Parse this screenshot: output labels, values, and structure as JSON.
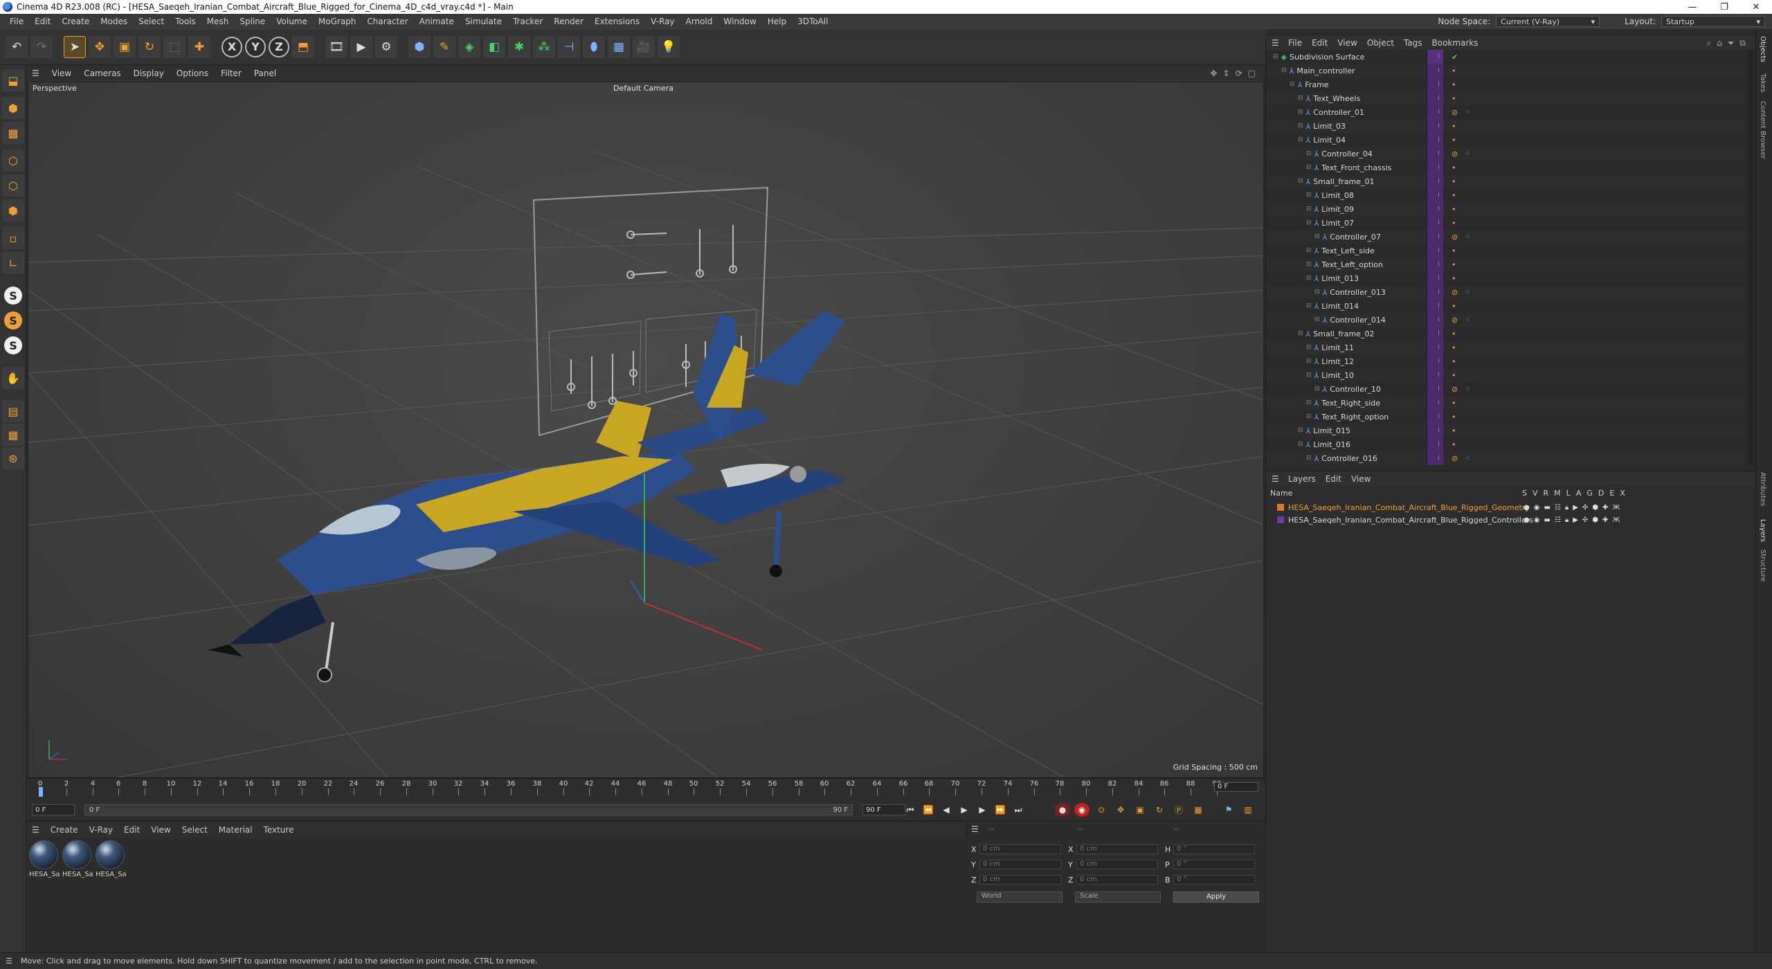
{
  "window": {
    "title": "Cinema 4D R23.008 (RC) - [HESA_Saeqeh_Iranian_Combat_Aircraft_Blue_Rigged_for_Cinema_4D_c4d_vray.c4d *] - Main"
  },
  "menubar": {
    "items": [
      "File",
      "Edit",
      "Create",
      "Modes",
      "Select",
      "Tools",
      "Mesh",
      "Spline",
      "Volume",
      "MoGraph",
      "Character",
      "Animate",
      "Simulate",
      "Tracker",
      "Render",
      "Extensions",
      "V-Ray",
      "Arnold",
      "Window",
      "Help",
      "3DToAll"
    ],
    "node_space_label": "Node Space:",
    "node_space_value": "Current (V-Ray)",
    "layout_label": "Layout:",
    "layout_value": "Startup"
  },
  "viewport": {
    "menu": [
      "View",
      "Cameras",
      "Display",
      "Options",
      "Filter",
      "Panel"
    ],
    "projection": "Perspective",
    "camera": "Default Camera",
    "grid_spacing": "Grid Spacing : 500 cm"
  },
  "timeline": {
    "ticks": [
      "0",
      "2",
      "4",
      "6",
      "8",
      "10",
      "12",
      "14",
      "16",
      "18",
      "20",
      "22",
      "24",
      "26",
      "28",
      "30",
      "32",
      "34",
      "36",
      "38",
      "40",
      "42",
      "44",
      "46",
      "48",
      "50",
      "52",
      "54",
      "56",
      "58",
      "60",
      "62",
      "64",
      "66",
      "68",
      "70",
      "72",
      "74",
      "76",
      "78",
      "80",
      "82",
      "84",
      "86",
      "88",
      "90"
    ],
    "current_frame": "0 F",
    "start_frame": "0 F",
    "range_start": "0 F",
    "range_end": "90 F",
    "end_frame": "90 F"
  },
  "materials": {
    "menu": [
      "Create",
      "V-Ray",
      "Edit",
      "View",
      "Select",
      "Material",
      "Texture"
    ],
    "items": [
      "HESA_Sa",
      "HESA_Sa",
      "HESA_Sa"
    ]
  },
  "coordinates": {
    "pos_labels": [
      "X",
      "Y",
      "Z"
    ],
    "size_labels": [
      "X",
      "Y",
      "Z"
    ],
    "rot_labels": [
      "H",
      "P",
      "B"
    ],
    "pos_values": [
      "0 cm",
      "0 cm",
      "0 cm"
    ],
    "size_values": [
      "0 cm",
      "0 cm",
      "0 cm"
    ],
    "rot_values": [
      "0 °",
      "0 °",
      "0 °"
    ],
    "mode": "World",
    "scale": "Scale",
    "apply": "Apply",
    "dashes": [
      "--",
      "--",
      "--"
    ]
  },
  "status": {
    "text": "Move: Click and drag to move elements. Hold down SHIFT to quantize movement / add to the selection in point mode, CTRL to remove."
  },
  "object_manager": {
    "menu": [
      "File",
      "Edit",
      "View",
      "Object",
      "Tags",
      "Bookmarks"
    ],
    "objects": [
      {
        "name": "Subdivision Surface",
        "depth": 0,
        "tag": "check"
      },
      {
        "name": "Main_controller",
        "depth": 1,
        "tag": "dot"
      },
      {
        "name": "Frame",
        "depth": 2,
        "tag": "dot"
      },
      {
        "name": "Text_Wheels",
        "depth": 3,
        "tag": "dot"
      },
      {
        "name": "Controller_01",
        "depth": 3,
        "tag": "ctrl"
      },
      {
        "name": "Limit_03",
        "depth": 3,
        "tag": "dot"
      },
      {
        "name": "Limit_04",
        "depth": 3,
        "tag": "dot"
      },
      {
        "name": "Controller_04",
        "depth": 4,
        "tag": "ctrl"
      },
      {
        "name": "Text_Front_chassis",
        "depth": 4,
        "tag": "dot"
      },
      {
        "name": "Small_frame_01",
        "depth": 3,
        "tag": "dot"
      },
      {
        "name": "Limit_08",
        "depth": 4,
        "tag": "dot"
      },
      {
        "name": "Limit_09",
        "depth": 4,
        "tag": "dot"
      },
      {
        "name": "Limit_07",
        "depth": 4,
        "tag": "dot"
      },
      {
        "name": "Controller_07",
        "depth": 5,
        "tag": "ctrl"
      },
      {
        "name": "Text_Left_side",
        "depth": 4,
        "tag": "dot"
      },
      {
        "name": "Text_Left_option",
        "depth": 4,
        "tag": "dot"
      },
      {
        "name": "Limit_013",
        "depth": 4,
        "tag": "dot"
      },
      {
        "name": "Controller_013",
        "depth": 5,
        "tag": "ctrl"
      },
      {
        "name": "Limit_014",
        "depth": 4,
        "tag": "dot"
      },
      {
        "name": "Controller_014",
        "depth": 5,
        "tag": "ctrl"
      },
      {
        "name": "Small_frame_02",
        "depth": 3,
        "tag": "dot"
      },
      {
        "name": "Limit_11",
        "depth": 4,
        "tag": "dot"
      },
      {
        "name": "Limit_12",
        "depth": 4,
        "tag": "dot"
      },
      {
        "name": "Limit_10",
        "depth": 4,
        "tag": "dot"
      },
      {
        "name": "Controller_10",
        "depth": 5,
        "tag": "ctrl"
      },
      {
        "name": "Text_Right_side",
        "depth": 4,
        "tag": "dot"
      },
      {
        "name": "Text_Right_option",
        "depth": 4,
        "tag": "dot"
      },
      {
        "name": "Limit_015",
        "depth": 3,
        "tag": "dot"
      },
      {
        "name": "Limit_016",
        "depth": 3,
        "tag": "dot"
      },
      {
        "name": "Controller_016",
        "depth": 4,
        "tag": "ctrl"
      }
    ]
  },
  "layers": {
    "menu": [
      "Layers",
      "Edit",
      "View"
    ],
    "header_name": "Name",
    "header_cols": [
      "S",
      "V",
      "R",
      "M",
      "L",
      "A",
      "G",
      "D",
      "E",
      "X"
    ],
    "items": [
      {
        "name": "HESA_Saeqeh_Iranian_Combat_Aircraft_Blue_Rigged_Geometry",
        "color": "#e07a20",
        "text_color": "#f0a030"
      },
      {
        "name": "HESA_Saeqeh_Iranian_Combat_Aircraft_Blue_Rigged_Controllers",
        "color": "#6a3aa0",
        "text_color": "#d8d8d8"
      }
    ]
  },
  "right_tabs": [
    "Objects",
    "Takes",
    "Content Browser",
    "Attributes",
    "Layers",
    "Structure"
  ],
  "colors": {
    "accent": "#f0a030",
    "selection": "#e0a030",
    "object_icon": "#6aa8ff"
  }
}
